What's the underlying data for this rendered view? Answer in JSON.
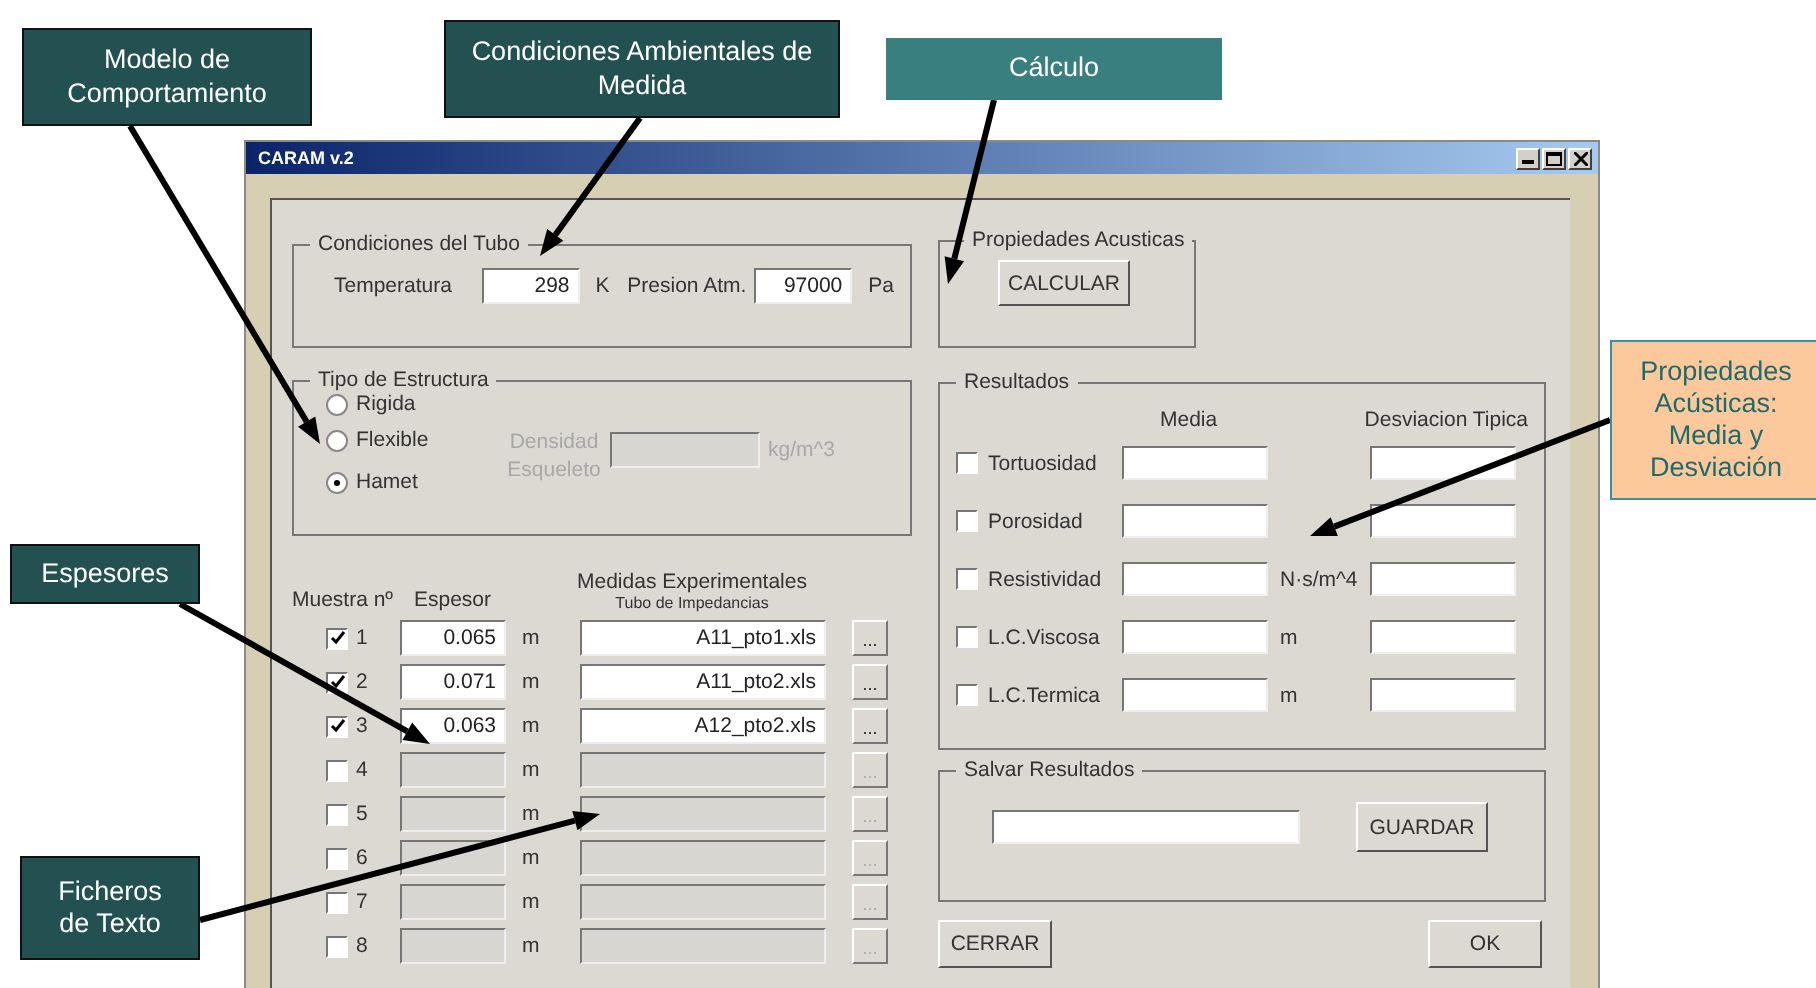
{
  "callouts": [
    {
      "kind": "dark",
      "text": "Modelo de Comportamiento"
    },
    {
      "kind": "dark",
      "text": "Condiciones Ambientales de Medida"
    },
    {
      "kind": "teal",
      "text": "Cálculo"
    },
    {
      "kind": "peach",
      "text": "Propiedades Acústicas: Media y Desviación"
    },
    {
      "kind": "dark",
      "text": "Espesores"
    },
    {
      "kind": "dark",
      "text": "Ficheros de Texto"
    }
  ],
  "window": {
    "title": "CARAM v.2"
  },
  "tube_conditions": {
    "title": "Condiciones del Tubo",
    "temperature": {
      "label": "Temperatura",
      "value": "298",
      "unit": "K"
    },
    "pressure": {
      "label": "Presion Atm.",
      "value": "97000",
      "unit": "Pa"
    }
  },
  "structure_type": {
    "title": "Tipo de Estructura",
    "options": [
      {
        "label": "Rigida",
        "selected": false
      },
      {
        "label": "Flexible",
        "selected": false
      },
      {
        "label": "Hamet",
        "selected": true
      }
    ],
    "density": {
      "label": "Densidad Esqueleto",
      "unit": "kg/m^3",
      "disabled": true
    }
  },
  "samples": {
    "headers": {
      "number": "Muestra nº",
      "thickness": "Espesor",
      "measures": "Medidas Experimentales",
      "measures_sub": "Tubo de Impedancias"
    },
    "rows": [
      {
        "number": "1",
        "checked": true,
        "disabled": false,
        "thickness": "0.065",
        "unit": "m",
        "file": "A11_pto1.xls",
        "browse": "..."
      },
      {
        "number": "2",
        "checked": true,
        "disabled": false,
        "thickness": "0.071",
        "unit": "m",
        "file": "A11_pto2.xls",
        "browse": "..."
      },
      {
        "number": "3",
        "checked": true,
        "disabled": false,
        "thickness": "0.063",
        "unit": "m",
        "file": "A12_pto2.xls",
        "browse": "..."
      },
      {
        "number": "4",
        "checked": false,
        "disabled": true,
        "unit": "m",
        "browse": "..."
      },
      {
        "number": "5",
        "checked": false,
        "disabled": true,
        "unit": "m",
        "browse": "..."
      },
      {
        "number": "6",
        "checked": false,
        "disabled": true,
        "unit": "m",
        "browse": "..."
      },
      {
        "number": "7",
        "checked": false,
        "disabled": true,
        "unit": "m",
        "browse": "..."
      },
      {
        "number": "8",
        "checked": false,
        "disabled": true,
        "unit": "m",
        "browse": "..."
      }
    ]
  },
  "acoustic_properties": {
    "title": "Propiedades Acusticas",
    "button": "CALCULAR"
  },
  "results": {
    "title": "Resultados",
    "columns": [
      "Media",
      "Desviacion Tipica"
    ],
    "rows": [
      {
        "label": "Tortuosidad",
        "checked": false
      },
      {
        "label": "Porosidad",
        "checked": false
      },
      {
        "label": "Resistividad",
        "checked": false,
        "unit": "N·s/m^4"
      },
      {
        "label": "L.C.Viscosa",
        "checked": false,
        "unit": "m"
      },
      {
        "label": "L.C.Termica",
        "checked": false,
        "unit": "m"
      }
    ]
  },
  "save_results": {
    "title": "Salvar Resultados",
    "button": "GUARDAR"
  },
  "buttons": [
    "CERRAR",
    "OK"
  ]
}
